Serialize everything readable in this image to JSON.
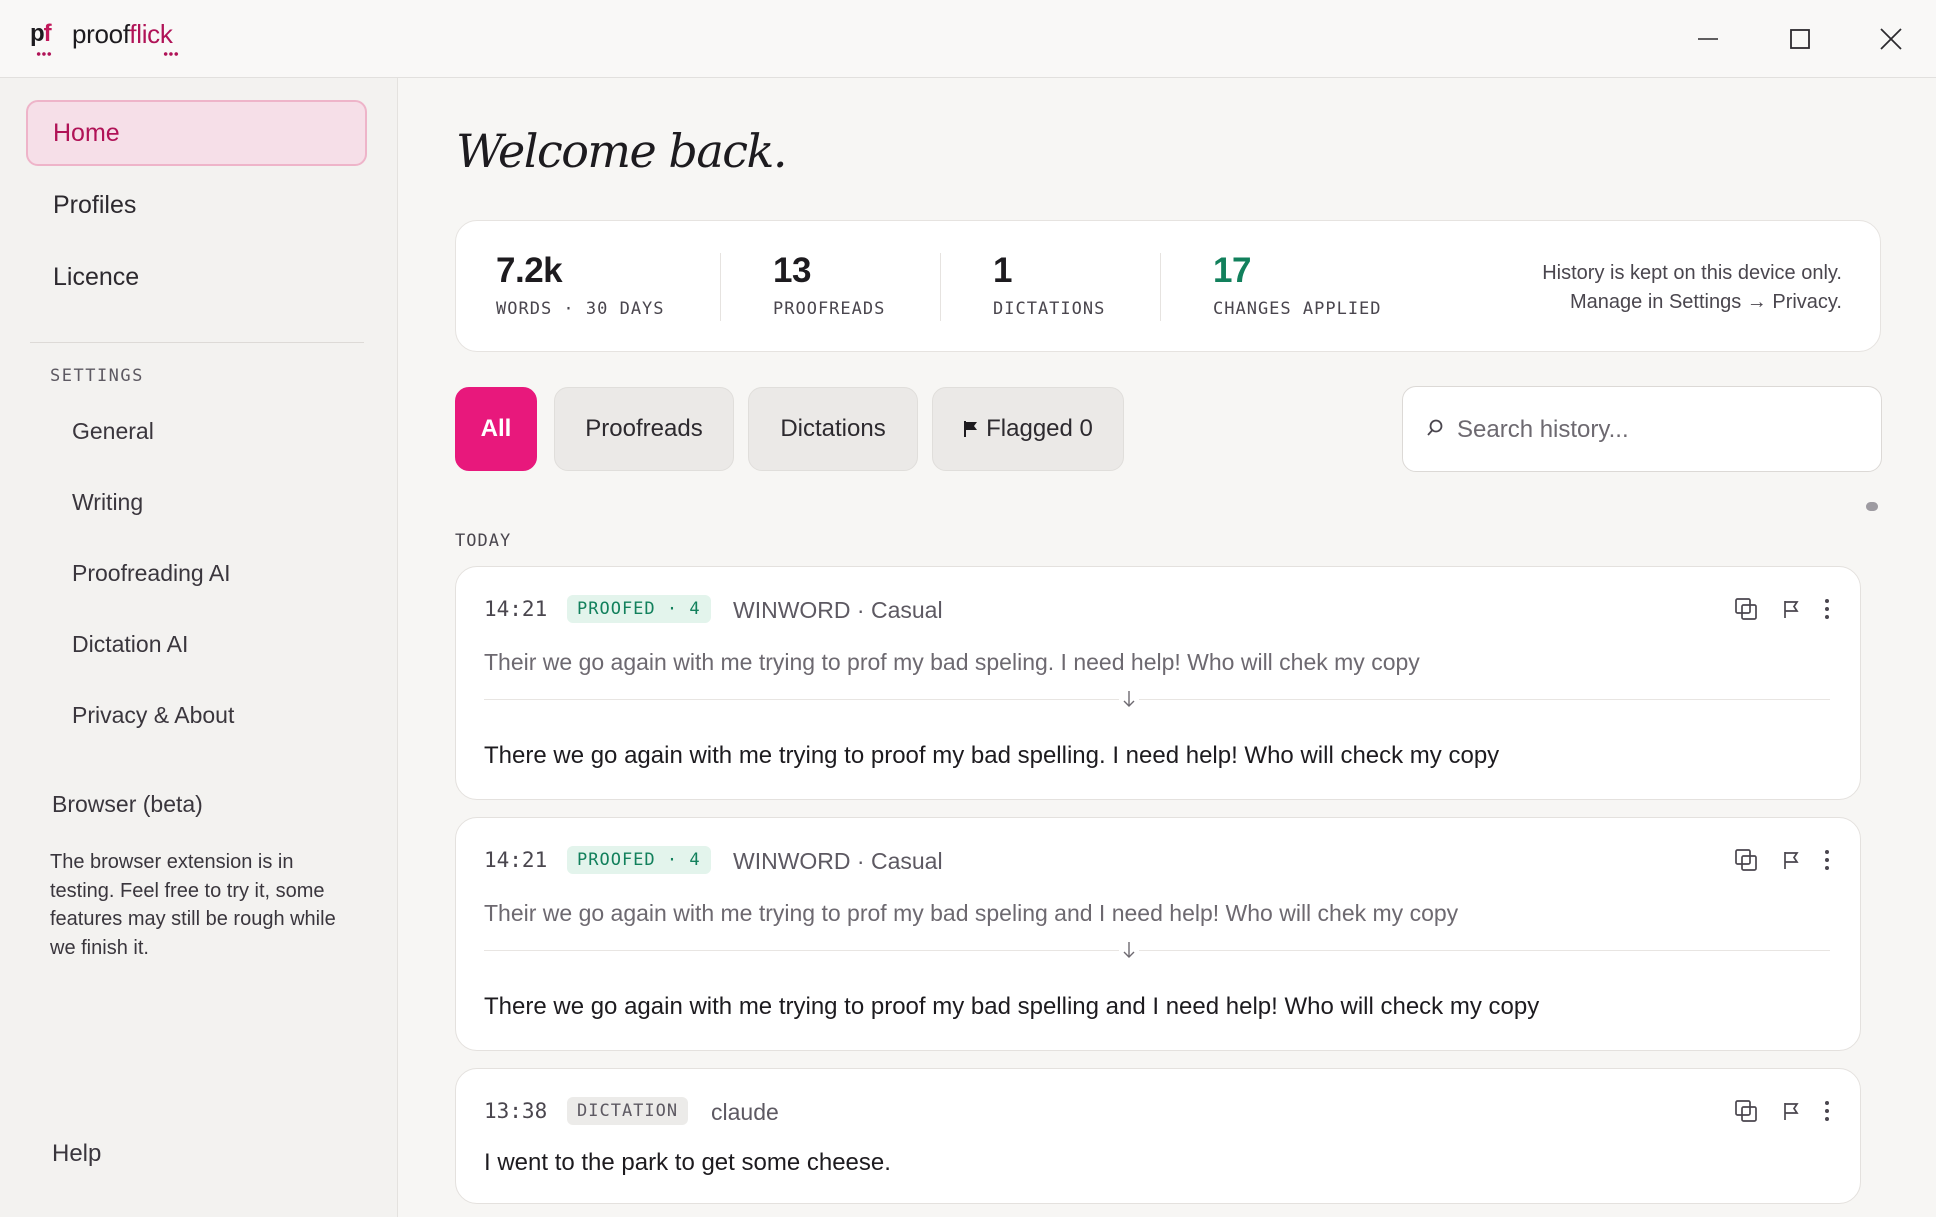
{
  "app": {
    "logo_p": "p",
    "logo_f": "f",
    "brand_a": "proof",
    "brand_b": "flick"
  },
  "window": {
    "minimize": "minimize",
    "maximize": "maximize",
    "close": "close"
  },
  "sidebar": {
    "nav": [
      {
        "label": "Home",
        "active": true
      },
      {
        "label": "Profiles"
      },
      {
        "label": "Licence"
      }
    ],
    "settings_label": "SETTINGS",
    "settings": [
      "General",
      "Writing",
      "Proofreading AI",
      "Dictation AI",
      "Privacy & About"
    ],
    "browser_beta": "Browser (beta)",
    "beta_text": "The browser extension is in testing. Feel free to try it, some features may still be rough while we finish it.",
    "help": "Help"
  },
  "main": {
    "welcome": "Welcome back.",
    "stats": [
      {
        "value": "7.2k",
        "label": "WORDS · 30 DAYS"
      },
      {
        "value": "13",
        "label": "PROOFREADS"
      },
      {
        "value": "1",
        "label": "DICTATIONS"
      },
      {
        "value": "17",
        "label": "CHANGES APPLIED"
      }
    ],
    "stats_note_line1": "History is kept on this device only.",
    "stats_note_line2": "Manage in Settings → Privacy.",
    "filters": [
      "All",
      "Proofreads",
      "Dictations",
      "Flagged 0"
    ],
    "search_placeholder": "Search history...",
    "day_label": "TODAY",
    "entries": [
      {
        "time": "14:21",
        "tag": "PROOFED · 4",
        "source": "WINWORD · Casual",
        "original": "Their we go again with me trying to prof my bad speling. I need help! Who will chek my copy",
        "corrected": "There we go again with me trying to proof my bad spelling. I need help! Who will check my copy"
      },
      {
        "time": "14:21",
        "tag": "PROOFED · 4",
        "source": "WINWORD · Casual",
        "original": "Their we go again with me trying to prof my bad speling and I need help! Who will chek my copy",
        "corrected": "There we go again with me trying to proof my bad spelling and I need help! Who will check my copy"
      },
      {
        "time": "13:38",
        "tag": "DICTATION",
        "source": "claude",
        "text": "I went to the park to get some cheese."
      }
    ]
  },
  "colors": {
    "accent": "#e8187c",
    "brand": "#b01357",
    "success": "#12805c"
  }
}
